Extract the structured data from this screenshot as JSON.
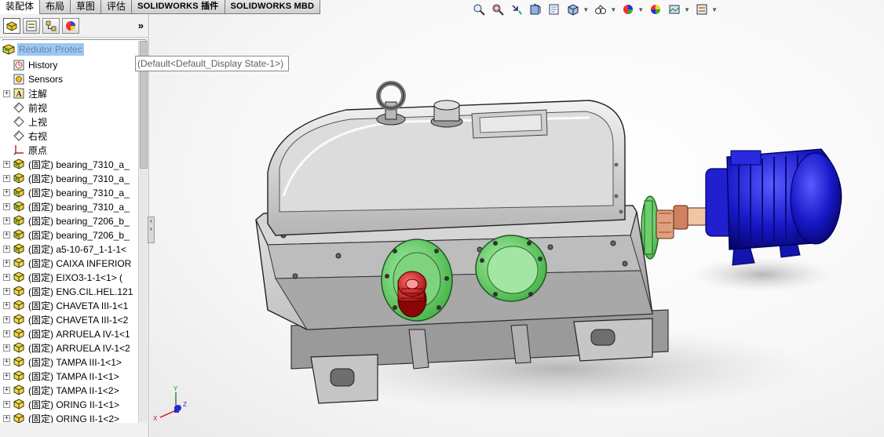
{
  "tabs": [
    {
      "label": "装配体",
      "active": true
    },
    {
      "label": "布局",
      "active": false
    },
    {
      "label": "草图",
      "active": false
    },
    {
      "label": "评估",
      "active": false
    },
    {
      "label": "SOLIDWORKS 插件",
      "active": false
    },
    {
      "label": "SOLIDWORKS MBD",
      "active": false
    }
  ],
  "panel": {
    "tab_icons": [
      "featuremanager-tree-icon",
      "property-manager-icon",
      "configuration-manager-icon",
      "display-manager-icon"
    ],
    "more_glyph": "»",
    "filter_icon": "filter-icon"
  },
  "tree": {
    "root_label": "Redutor Protec",
    "tooltip": "(Default<Default_Display State-1>)",
    "items": [
      {
        "label": "History",
        "icon": "history-icon",
        "expandable": false
      },
      {
        "label": "Sensors",
        "icon": "sensors-icon",
        "expandable": false
      },
      {
        "label": "注解",
        "icon": "annotations-icon",
        "expandable": true
      },
      {
        "label": "前视",
        "icon": "plane-icon",
        "expandable": false
      },
      {
        "label": "上视",
        "icon": "plane-icon",
        "expandable": false
      },
      {
        "label": "右视",
        "icon": "plane-icon",
        "expandable": false
      },
      {
        "label": "原点",
        "icon": "origin-icon",
        "expandable": false
      },
      {
        "label": "(固定) bearing_7310_a_",
        "icon": "assembly-icon",
        "expandable": true
      },
      {
        "label": "(固定) bearing_7310_a_",
        "icon": "assembly-icon",
        "expandable": true
      },
      {
        "label": "(固定) bearing_7310_a_",
        "icon": "assembly-icon",
        "expandable": true
      },
      {
        "label": "(固定) bearing_7310_a_",
        "icon": "assembly-icon",
        "expandable": true
      },
      {
        "label": "(固定) bearing_7206_b_",
        "icon": "assembly-icon",
        "expandable": true
      },
      {
        "label": "(固定) bearing_7206_b_",
        "icon": "assembly-icon",
        "expandable": true
      },
      {
        "label": "(固定) a5-10-67_1-1-1<",
        "icon": "assembly-icon",
        "expandable": true
      },
      {
        "label": "(固定) CAIXA INFERIOR",
        "icon": "part-icon",
        "expandable": true
      },
      {
        "label": "(固定) EIXO3-1-1<1> (",
        "icon": "part-icon",
        "expandable": true
      },
      {
        "label": "(固定) ENG.CIL.HEL.121",
        "icon": "part-icon",
        "expandable": true
      },
      {
        "label": "(固定) CHAVETA III-1<1",
        "icon": "part-icon",
        "expandable": true
      },
      {
        "label": "(固定) CHAVETA III-1<2",
        "icon": "part-icon",
        "expandable": true
      },
      {
        "label": "(固定) ARRUELA IV-1<1",
        "icon": "part-icon",
        "expandable": true
      },
      {
        "label": "(固定) ARRUELA IV-1<2",
        "icon": "part-icon",
        "expandable": true
      },
      {
        "label": "(固定) TAMPA III-1<1>",
        "icon": "part-icon",
        "expandable": true
      },
      {
        "label": "(固定) TAMPA II-1<1>",
        "icon": "part-icon",
        "expandable": true
      },
      {
        "label": "(固定) TAMPA II-1<2>",
        "icon": "part-icon",
        "expandable": true
      },
      {
        "label": "(固定) ORING II-1<1>",
        "icon": "part-icon",
        "expandable": true
      },
      {
        "label": "(固定) ORING II-1<2>",
        "icon": "part-icon",
        "expandable": true
      }
    ]
  },
  "heads_up_toolbar": [
    {
      "icon": "zoom-to-fit-icon",
      "caret": false
    },
    {
      "icon": "zoom-to-area-icon",
      "caret": false
    },
    {
      "icon": "previous-view-icon",
      "caret": false
    },
    {
      "icon": "section-view-icon",
      "caret": false
    },
    {
      "icon": "dynamic-annotation-icon",
      "caret": false
    },
    {
      "icon": "view-orientation-icon",
      "caret": true
    },
    {
      "icon": "display-style-icon",
      "caret": true
    },
    {
      "icon": "hide-show-items-icon",
      "caret": true
    },
    {
      "icon": "edit-appearance-icon",
      "caret": false
    },
    {
      "icon": "apply-scene-icon",
      "caret": true
    },
    {
      "icon": "view-settings-icon",
      "caret": true
    }
  ],
  "triad": {
    "x_label": "X",
    "y_label": "Y",
    "z_label": "Z"
  },
  "colors": {
    "housing": "#c8c8c8",
    "flange_green": "#5fd35f",
    "motor_blue": "#1a1ad0",
    "shaft_red": "#cc1010",
    "coupling": "#d08060",
    "selection": "#9cc7f3"
  }
}
